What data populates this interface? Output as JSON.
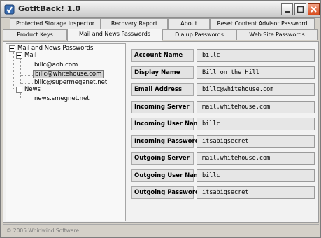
{
  "window": {
    "title": "GotItBack! 1.0"
  },
  "tabs_row1": [
    {
      "label": "Protected Storage Inspector"
    },
    {
      "label": "Recovery Report"
    },
    {
      "label": "About"
    },
    {
      "label": "Reset Content Advisor Password"
    }
  ],
  "tabs_row2": [
    {
      "label": "Product Keys"
    },
    {
      "label": "Mail and  News Passwords"
    },
    {
      "label": "Dialup Passwords"
    },
    {
      "label": "Web Site Passwords"
    }
  ],
  "tree": {
    "root": "Mail and News Passwords",
    "mail": "Mail",
    "mail_items": [
      "billc@aoh.com",
      "billc@whitehouse.com",
      "billc@supermeganet.net"
    ],
    "news": "News",
    "news_items": [
      "news.smegnet.net"
    ]
  },
  "fields": [
    {
      "label": "Account Name",
      "value": "billc"
    },
    {
      "label": "Display Name",
      "value": "Bill on the Hill"
    },
    {
      "label": "Email Address",
      "value": "billc@whitehouse.com"
    },
    {
      "label": "Incoming Server",
      "value": "mail.whitehouse.com"
    },
    {
      "label": "Incoming User Name",
      "value": "billc"
    },
    {
      "label": "Incoming Password",
      "value": "itsabigsecret"
    },
    {
      "label": "Outgoing Server",
      "value": "mail.whitehouse.com"
    },
    {
      "label": "Outgoing User Name",
      "value": "billc"
    },
    {
      "label": "Outgoing Password",
      "value": "itsabigsecret"
    }
  ],
  "status": {
    "text": "© 2005 Whirlwind Software"
  },
  "colors": {
    "close_button": "#d84b1c",
    "selection": "#d3d3d3"
  }
}
